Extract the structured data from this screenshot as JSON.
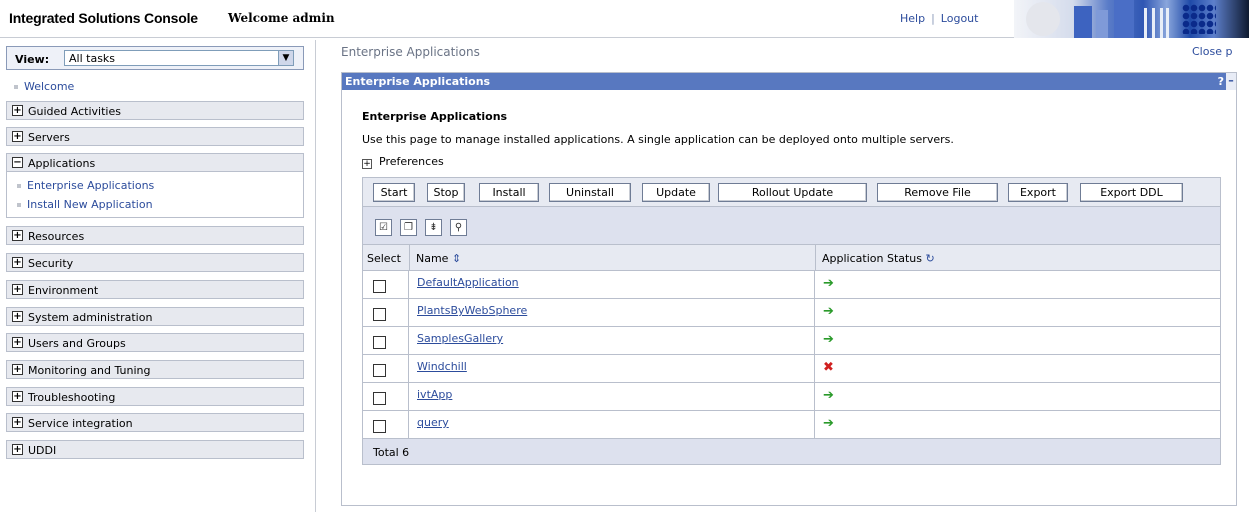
{
  "header": {
    "app_title": "Integrated Solutions Console",
    "welcome": "Welcome admin",
    "help": "Help",
    "separator": "|",
    "logout": "Logout"
  },
  "sidebar": {
    "view_label": "View:",
    "view_value": "All tasks",
    "welcome_link": "Welcome",
    "groups": [
      {
        "label": "Guided Activities",
        "toggle": "+"
      },
      {
        "label": "Servers",
        "toggle": "+"
      },
      {
        "label": "Applications",
        "toggle": "−"
      },
      {
        "label": "Resources",
        "toggle": "+"
      },
      {
        "label": "Security",
        "toggle": "+"
      },
      {
        "label": "Environment",
        "toggle": "+"
      },
      {
        "label": "System administration",
        "toggle": "+"
      },
      {
        "label": "Users and Groups",
        "toggle": "+"
      },
      {
        "label": "Monitoring and Tuning",
        "toggle": "+"
      },
      {
        "label": "Troubleshooting",
        "toggle": "+"
      },
      {
        "label": "Service integration",
        "toggle": "+"
      },
      {
        "label": "UDDI",
        "toggle": "+"
      }
    ],
    "app_items": [
      "Enterprise Applications",
      "Install New Application"
    ]
  },
  "main": {
    "breadcrumb": "Enterprise Applications",
    "close_page": "Close p",
    "panel_title": "Enterprise Applications",
    "help_mark": "?",
    "minimize": "–",
    "heading": "Enterprise Applications",
    "description": "Use this page to manage installed applications. A single application can be deployed onto multiple servers.",
    "preferences": "Preferences",
    "buttons": [
      "Start",
      "Stop",
      "Install",
      "Uninstall",
      "Update",
      "Rollout Update",
      "Remove File",
      "Export",
      "Export DDL"
    ],
    "table": {
      "col_select": "Select",
      "col_name": "Name",
      "col_status": "Application Status",
      "rows": [
        {
          "name": "DefaultApplication",
          "status": "started"
        },
        {
          "name": "PlantsByWebSphere",
          "status": "started"
        },
        {
          "name": "SamplesGallery",
          "status": "started"
        },
        {
          "name": "Windchill",
          "status": "stopped"
        },
        {
          "name": "ivtApp",
          "status": "started"
        },
        {
          "name": "query",
          "status": "started"
        }
      ],
      "total": "Total 6"
    }
  },
  "colors": {
    "started": "#2a9a2a",
    "stopped": "#d02020",
    "title_bar": "#5878c0",
    "link": "#2c4c9c"
  }
}
